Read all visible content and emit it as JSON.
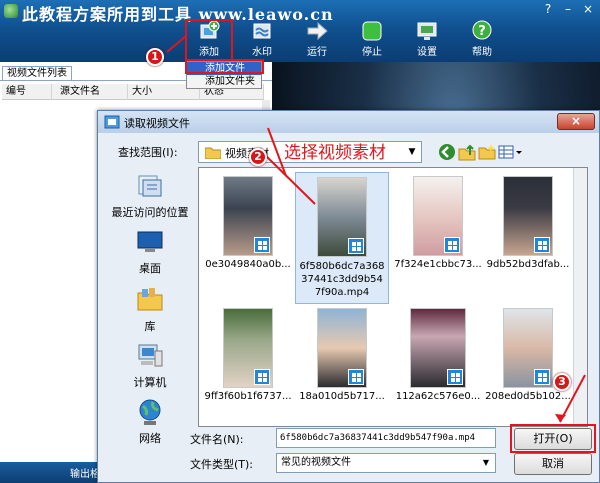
{
  "app": {
    "title": "此教程方案所用到工具 www.leawo.cn",
    "window_buttons": [
      "?",
      "–",
      "×"
    ]
  },
  "toolbar": {
    "items": [
      {
        "label": "添加",
        "icon": "add-video-icon"
      },
      {
        "label": "水印",
        "icon": "watermark-icon"
      },
      {
        "label": "运行",
        "icon": "run-arrow-icon"
      },
      {
        "label": "停止",
        "icon": "stop-icon"
      },
      {
        "label": "设置",
        "icon": "settings-monitor-icon"
      },
      {
        "label": "帮助",
        "icon": "help-icon"
      }
    ]
  },
  "add_menu": {
    "items": [
      "添加文件",
      "添加文件夹"
    ],
    "selected": "添加文件"
  },
  "left_panel": {
    "tab": "视频文件列表",
    "columns": [
      "编号",
      "源文件名",
      "大小",
      "状态"
    ],
    "footer": "输出格"
  },
  "dialog": {
    "title": "读取视频文件",
    "close_label": "×",
    "look_in_label": "查找范围(I):",
    "look_in_value": "视频素材",
    "places": [
      "最近访问的位置",
      "桌面",
      "库",
      "计算机",
      "网络"
    ],
    "files": [
      "0e3049840a0b...",
      "6f580b6dc7a36837441c3dd9b547f90a.mp4",
      "7f324e1cbbc73...",
      "9db52bd3dfab...",
      "9ff3f60b1f6737...",
      "18a010d5b717...",
      "112a62c576e0...",
      "208ed0d5b102..."
    ],
    "selected_file": "6f580b6dc7a36837441c3dd9b547f90a.mp4",
    "filename_label": "文件名(N):",
    "filename_value": "6f580b6dc7a36837441c3dd9b547f90a.mp4",
    "filetype_label": "文件类型(T):",
    "filetype_value": "常见的视频文件",
    "open_label": "打开(O)",
    "cancel_label": "取消"
  },
  "annotations": {
    "step_labels": [
      "1",
      "2",
      "3"
    ],
    "callout_text": "选择视频素材",
    "highlight_color": "#e4141d"
  },
  "colors": {
    "toolbar_bg": "#10508f",
    "dialog_bg": "#e8eef6",
    "selection": "#2f63c9"
  }
}
